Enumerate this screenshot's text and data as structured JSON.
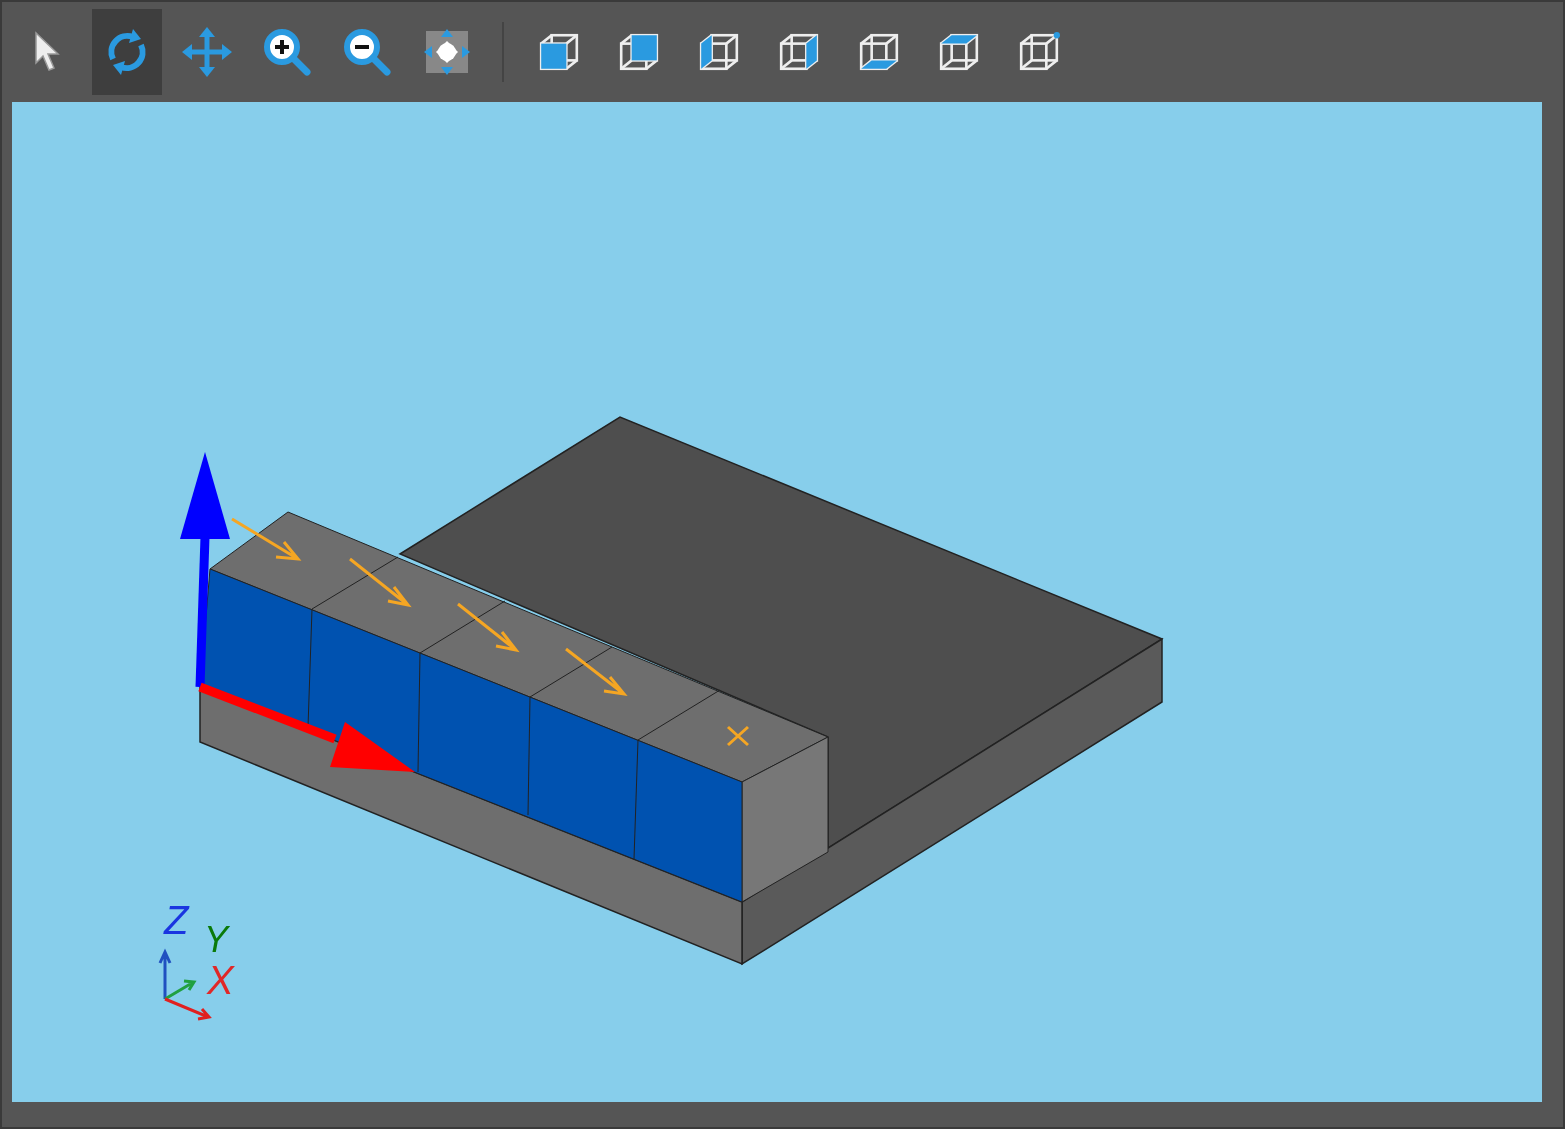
{
  "toolbar": {
    "tools": [
      {
        "kind": "select",
        "selected": false
      },
      {
        "kind": "rotate",
        "selected": true
      },
      {
        "kind": "pan",
        "selected": false
      },
      {
        "kind": "zoom-in",
        "selected": false
      },
      {
        "kind": "zoom-out",
        "selected": false
      },
      {
        "kind": "fit",
        "selected": false
      },
      {
        "kind": "view-front",
        "selected": false
      },
      {
        "kind": "view-back",
        "selected": false
      },
      {
        "kind": "view-left",
        "selected": false
      },
      {
        "kind": "view-right",
        "selected": false
      },
      {
        "kind": "view-bottom",
        "selected": false
      },
      {
        "kind": "view-top",
        "selected": false
      },
      {
        "kind": "view-iso",
        "selected": false
      }
    ]
  },
  "viewport": {
    "axis_triad": {
      "z_label": "Z",
      "y_label": "Y",
      "x_label": "X"
    }
  }
}
